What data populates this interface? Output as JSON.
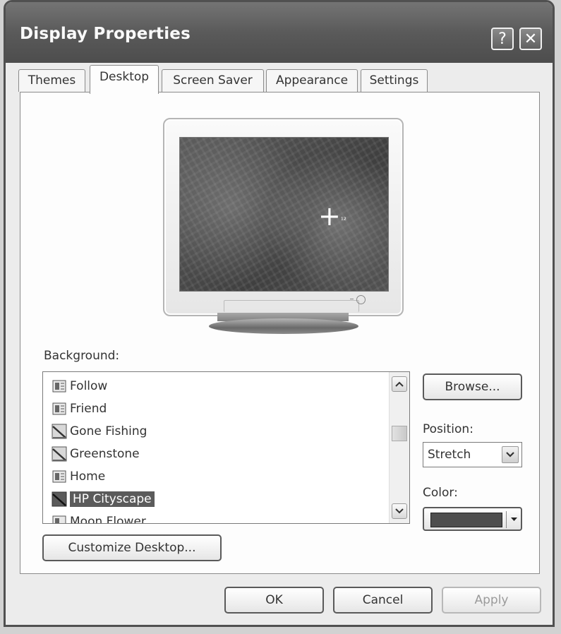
{
  "window": {
    "title": "Display Properties",
    "help_glyph": "?",
    "close_glyph": "✕"
  },
  "tabs": [
    {
      "label": "Themes",
      "active": false
    },
    {
      "label": "Desktop",
      "active": true
    },
    {
      "label": "Screen Saver",
      "active": false
    },
    {
      "label": "Appearance",
      "active": false
    },
    {
      "label": "Settings",
      "active": false
    }
  ],
  "preview": {
    "cursor_glyph": "+",
    "cursor_sub": "¹²"
  },
  "background": {
    "label": "Background:",
    "items": [
      {
        "name": "Follow",
        "icon": "bitmap-file-icon"
      },
      {
        "name": "Friend",
        "icon": "bitmap-file-icon"
      },
      {
        "name": "Gone Fishing",
        "icon": "picture-file-icon"
      },
      {
        "name": "Greenstone",
        "icon": "picture-file-icon"
      },
      {
        "name": "Home",
        "icon": "bitmap-file-icon"
      },
      {
        "name": "HP Cityscape",
        "icon": "picture-file-icon",
        "selected": true
      },
      {
        "name": "Moon Flower",
        "icon": "bitmap-file-icon"
      }
    ]
  },
  "buttons": {
    "browse": "Browse...",
    "customize": "Customize Desktop...",
    "ok": "OK",
    "cancel": "Cancel",
    "apply": "Apply"
  },
  "position": {
    "label": "Position:",
    "value": "Stretch"
  },
  "color": {
    "label": "Color:",
    "value": "#4e4e4e"
  }
}
